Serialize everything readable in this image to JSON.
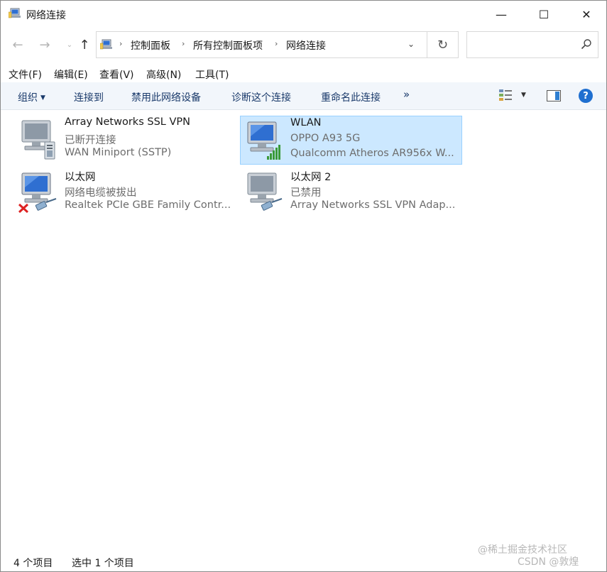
{
  "window": {
    "title": "网络连接",
    "controls": {
      "minimize": "—",
      "maximize": "☐",
      "close": "✕"
    }
  },
  "nav": {
    "back": "←",
    "forward": "→",
    "recent": "⌄",
    "up": "↑",
    "breadcrumbs": [
      "控制面板",
      "所有控制面板项",
      "网络连接"
    ],
    "separator": "›",
    "dropdown": "⌄",
    "refresh": "↻"
  },
  "search": {
    "placeholder": "",
    "icon": "⚲"
  },
  "menu": [
    "文件(F)",
    "编辑(E)",
    "查看(V)",
    "高级(N)",
    "工具(T)"
  ],
  "commands": {
    "organize": "组织",
    "connect": "连接到",
    "disable": "禁用此网络设备",
    "diagnose": "诊断这个连接",
    "rename": "重命名此连接",
    "more": "»",
    "help": "?"
  },
  "connections": [
    {
      "name": "Array Networks SSL VPN",
      "status": "已断开连接",
      "device": "WAN Miniport (SSTP)",
      "icon": "vpn-icon",
      "selected": false
    },
    {
      "name": "WLAN",
      "status": "OPPO A93 5G",
      "device": "Qualcomm Atheros AR956x W...",
      "icon": "wifi-icon",
      "selected": true
    },
    {
      "name": "以太网",
      "status": "网络电缆被拔出",
      "device": "Realtek PCIe GBE Family Contr...",
      "icon": "ethernet-unplugged-icon",
      "selected": false
    },
    {
      "name": "以太网 2",
      "status": "已禁用",
      "device": "Array Networks SSL VPN Adap...",
      "icon": "ethernet-icon",
      "selected": false
    }
  ],
  "status": {
    "count": "4 个项目",
    "selection": "选中 1 个项目"
  },
  "watermark": {
    "line1": "@稀土掘金技术社区",
    "line2": "CSDN @敦煌"
  },
  "colors": {
    "selected_bg": "#cce8ff",
    "selected_border": "#99d1ff",
    "command_bar": "#f2f6fb",
    "link": "#1a3a6b"
  }
}
